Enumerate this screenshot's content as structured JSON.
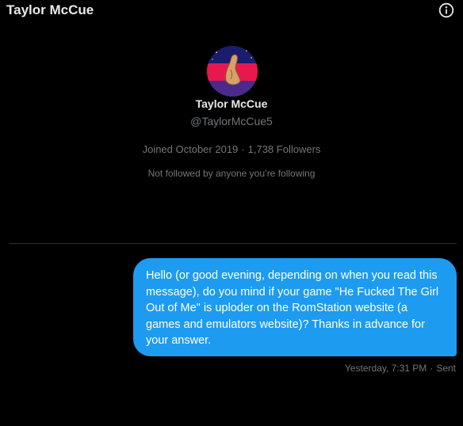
{
  "header": {
    "title": "Taylor McCue",
    "info_icon": "info-circle-icon"
  },
  "profile": {
    "name": "Taylor McCue",
    "handle": "@TaylorMcCue5",
    "joined": "Joined October 2019",
    "separator": "·",
    "followers": "1,738 Followers",
    "followed_by": "Not followed by anyone you’re following",
    "avatar_colors": {
      "top": "#1b1c6e",
      "middle": "#e8184f",
      "bottom": "#4a2a8a",
      "figure": "#d6a26a"
    }
  },
  "conversation": {
    "messages": [
      {
        "text": "Hello (or good evening, depending on when you read this message), do you mind if your game \"He Fucked The Girl Out of Me\" is uploder on the RomStation website (a games and emulators website)? Thanks in advance for your answer.",
        "timestamp": "Yesterday, 7:31 PM",
        "separator": "·",
        "status": "Sent"
      }
    ]
  },
  "colors": {
    "background": "#000000",
    "accent": "#1d9bf0",
    "primary_text": "#e7e9ea",
    "secondary_text": "#71767b",
    "divider": "#2f3336"
  }
}
